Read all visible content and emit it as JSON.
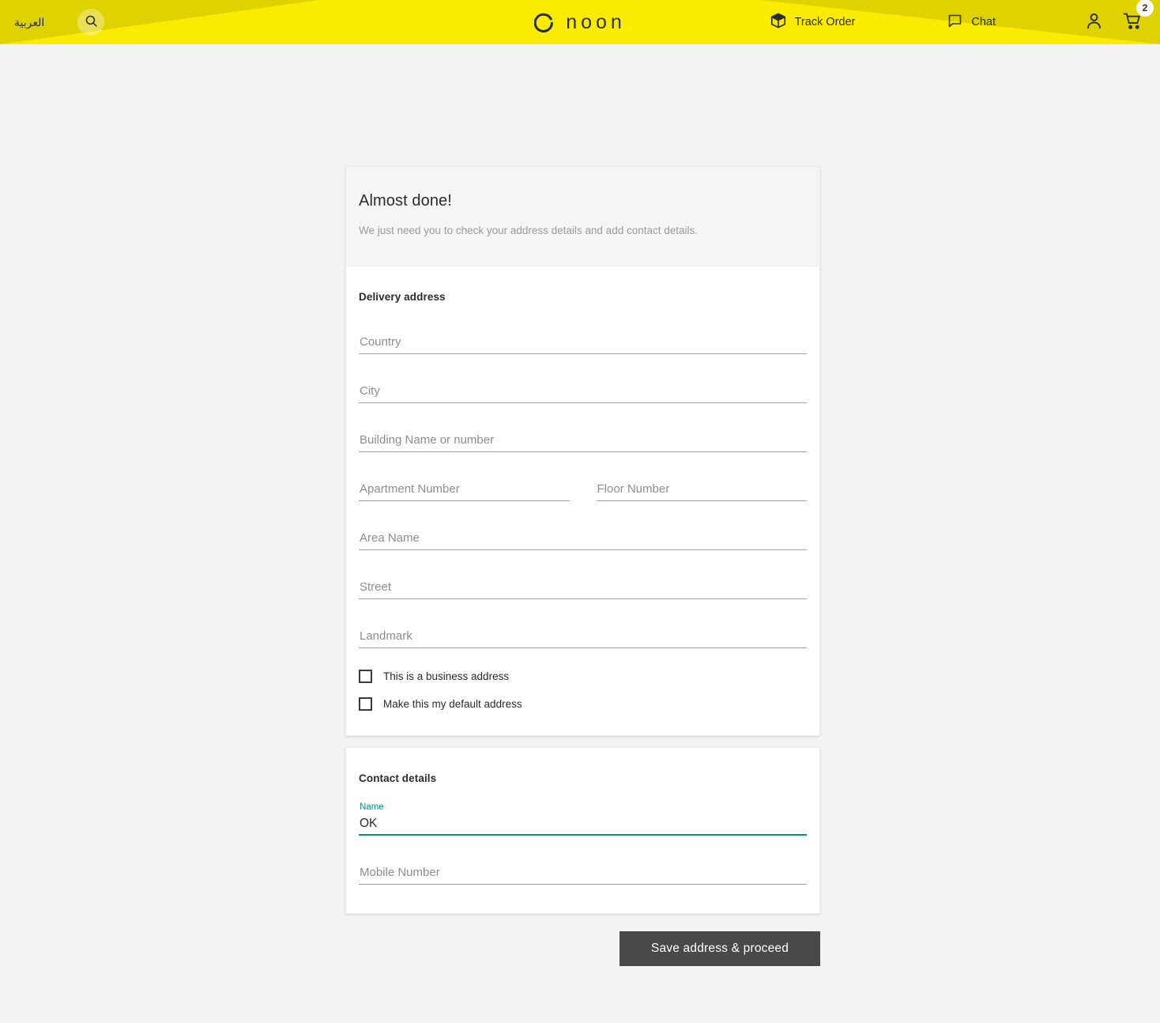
{
  "header": {
    "lang_label": "العربية",
    "search_icon": "search-icon",
    "track_order": {
      "label": "Track Order",
      "icon": "package-icon"
    },
    "chat": {
      "label": "Chat",
      "icon": "chat-bubble-icon"
    },
    "account_icon": "user-account-icon",
    "cart": {
      "icon": "shopping-cart-icon",
      "badge_count": "2"
    },
    "brand": "noon",
    "colors": {
      "yellow_bright": "#faec00",
      "yellow_dim": "#ded200",
      "text": "#2d2d2d"
    }
  },
  "intro": {
    "title": "Almost done!",
    "subtitle": "We just need you to check your address details and add contact details."
  },
  "delivery_address": {
    "section_title": "Delivery address",
    "fields": [
      {
        "name": "country",
        "placeholder": "Country",
        "value": ""
      },
      {
        "name": "city",
        "placeholder": "City",
        "value": ""
      },
      {
        "name": "building",
        "placeholder": "Building Name or number",
        "value": ""
      },
      {
        "name": "apartment",
        "placeholder": "Apartment Number",
        "value": ""
      },
      {
        "name": "floor",
        "placeholder": "Floor Number",
        "value": ""
      },
      {
        "name": "area",
        "placeholder": "Area Name",
        "value": ""
      },
      {
        "name": "street",
        "placeholder": "Street",
        "value": ""
      },
      {
        "name": "landmark",
        "placeholder": "Landmark",
        "value": ""
      }
    ],
    "checkboxes": [
      {
        "name": "business-address",
        "label": "This is a business address",
        "checked": false
      },
      {
        "name": "default-address",
        "label": "Make this my default address",
        "checked": false
      }
    ]
  },
  "contact_details": {
    "section_title": "Contact details",
    "name_field": {
      "label": "Name",
      "value": "OK",
      "accent_color": "#0a9083"
    },
    "mobile_field": {
      "placeholder": "Mobile Number",
      "value": ""
    }
  },
  "actions": {
    "save_label": "Save address & proceed",
    "button_color": "#494949"
  }
}
